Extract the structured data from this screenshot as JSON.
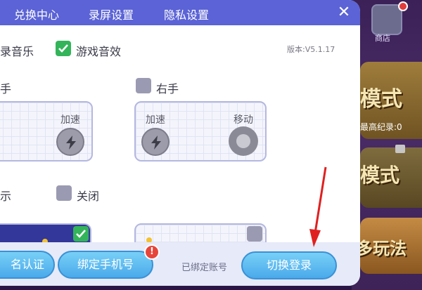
{
  "tabs": [
    "兑换中心",
    "录屏设置",
    "隐私设置"
  ],
  "close_label": "✕",
  "version": "版本:V5.1.17",
  "sound": {
    "music_label": "录音乐",
    "game_sfx_label": "游戏音效",
    "game_sfx_checked": true
  },
  "hand": {
    "left_label": "手",
    "right_label": "右手",
    "right_checked": false
  },
  "pad_left": {
    "speed_label": "加速"
  },
  "pad_right": {
    "speed_label": "加速",
    "move_label": "移动"
  },
  "display": {
    "left_label": "示",
    "off_label": "关闭",
    "off_checked": false
  },
  "bottom": {
    "auth_label": "名认证",
    "bind_phone_label": "绑定手机号",
    "badge": "!",
    "bound_account_label": "已绑定账号",
    "switch_login_label": "切换登录"
  },
  "background": {
    "shop_label": "商店",
    "mode1": "模式",
    "mode1_sub": "最高纪录:0",
    "mode2": "模式",
    "mode3": "多玩法"
  },
  "colors": {
    "topbar": "#5b63d6",
    "button": "#4aa9ea",
    "check_on": "#33b45a",
    "check_off": "#9a9ab2"
  },
  "icons": [
    "lightning-icon",
    "move-joystick-icon",
    "check-icon",
    "close-icon",
    "red-arrow"
  ]
}
